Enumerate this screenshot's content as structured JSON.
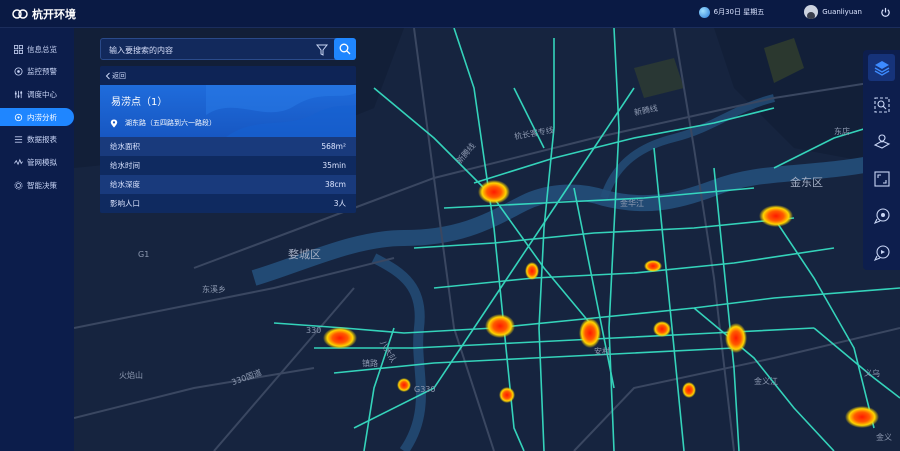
{
  "app": {
    "logo_text": "杭开环境"
  },
  "header": {
    "date": "6月30日 星期五",
    "username": "Guanliyuan"
  },
  "sidebar": {
    "items": [
      {
        "label": "信息总览",
        "icon": "grid-icon"
      },
      {
        "label": "监控预警",
        "icon": "monitor-icon"
      },
      {
        "label": "调度中心",
        "icon": "sliders-icon"
      },
      {
        "label": "内涝分析",
        "icon": "analysis-icon",
        "active": true
      },
      {
        "label": "数据报表",
        "icon": "list-icon"
      },
      {
        "label": "管网模拟",
        "icon": "wave-icon"
      },
      {
        "label": "智能决策",
        "icon": "gear-icon"
      }
    ]
  },
  "search": {
    "placeholder": "输入要搜索的内容"
  },
  "panel": {
    "back_label": "返回",
    "title": "易涝点（1）",
    "address": "湖东路（五四路到六一路段）",
    "rows": [
      {
        "label": "给水面积",
        "value": "568m²"
      },
      {
        "label": "给水时间",
        "value": "35min"
      },
      {
        "label": "给水深度",
        "value": "38cm"
      },
      {
        "label": "影响人口",
        "value": "3人"
      }
    ]
  },
  "map": {
    "labels": {
      "xinlong": "新腾线",
      "hangchang": "杭长客专线",
      "jindong": "金东区",
      "jinhua": "金华江",
      "wucheng": "婺城区",
      "dongxi": "东溪乡",
      "yanyan": "火焰山",
      "ancun": "安村",
      "zhenlu": "镇路",
      "dongdian": "东店",
      "yiwu": "义乌",
      "jinyi": "金义",
      "r1": "G1",
      "r2": "330",
      "r3": "G330",
      "r4": "330国道",
      "r5": "金义江",
      "r6": "八大队",
      "r7": "新腾线"
    }
  },
  "toolbar": {
    "tools": [
      "layers-icon",
      "zoom-search-icon",
      "route-icon",
      "fullscreen-icon",
      "chat-icon",
      "feedback-icon"
    ]
  },
  "colors": {
    "accent": "#1f86ff",
    "road": "#38e6c8",
    "hotspot": "#ff2a00"
  }
}
